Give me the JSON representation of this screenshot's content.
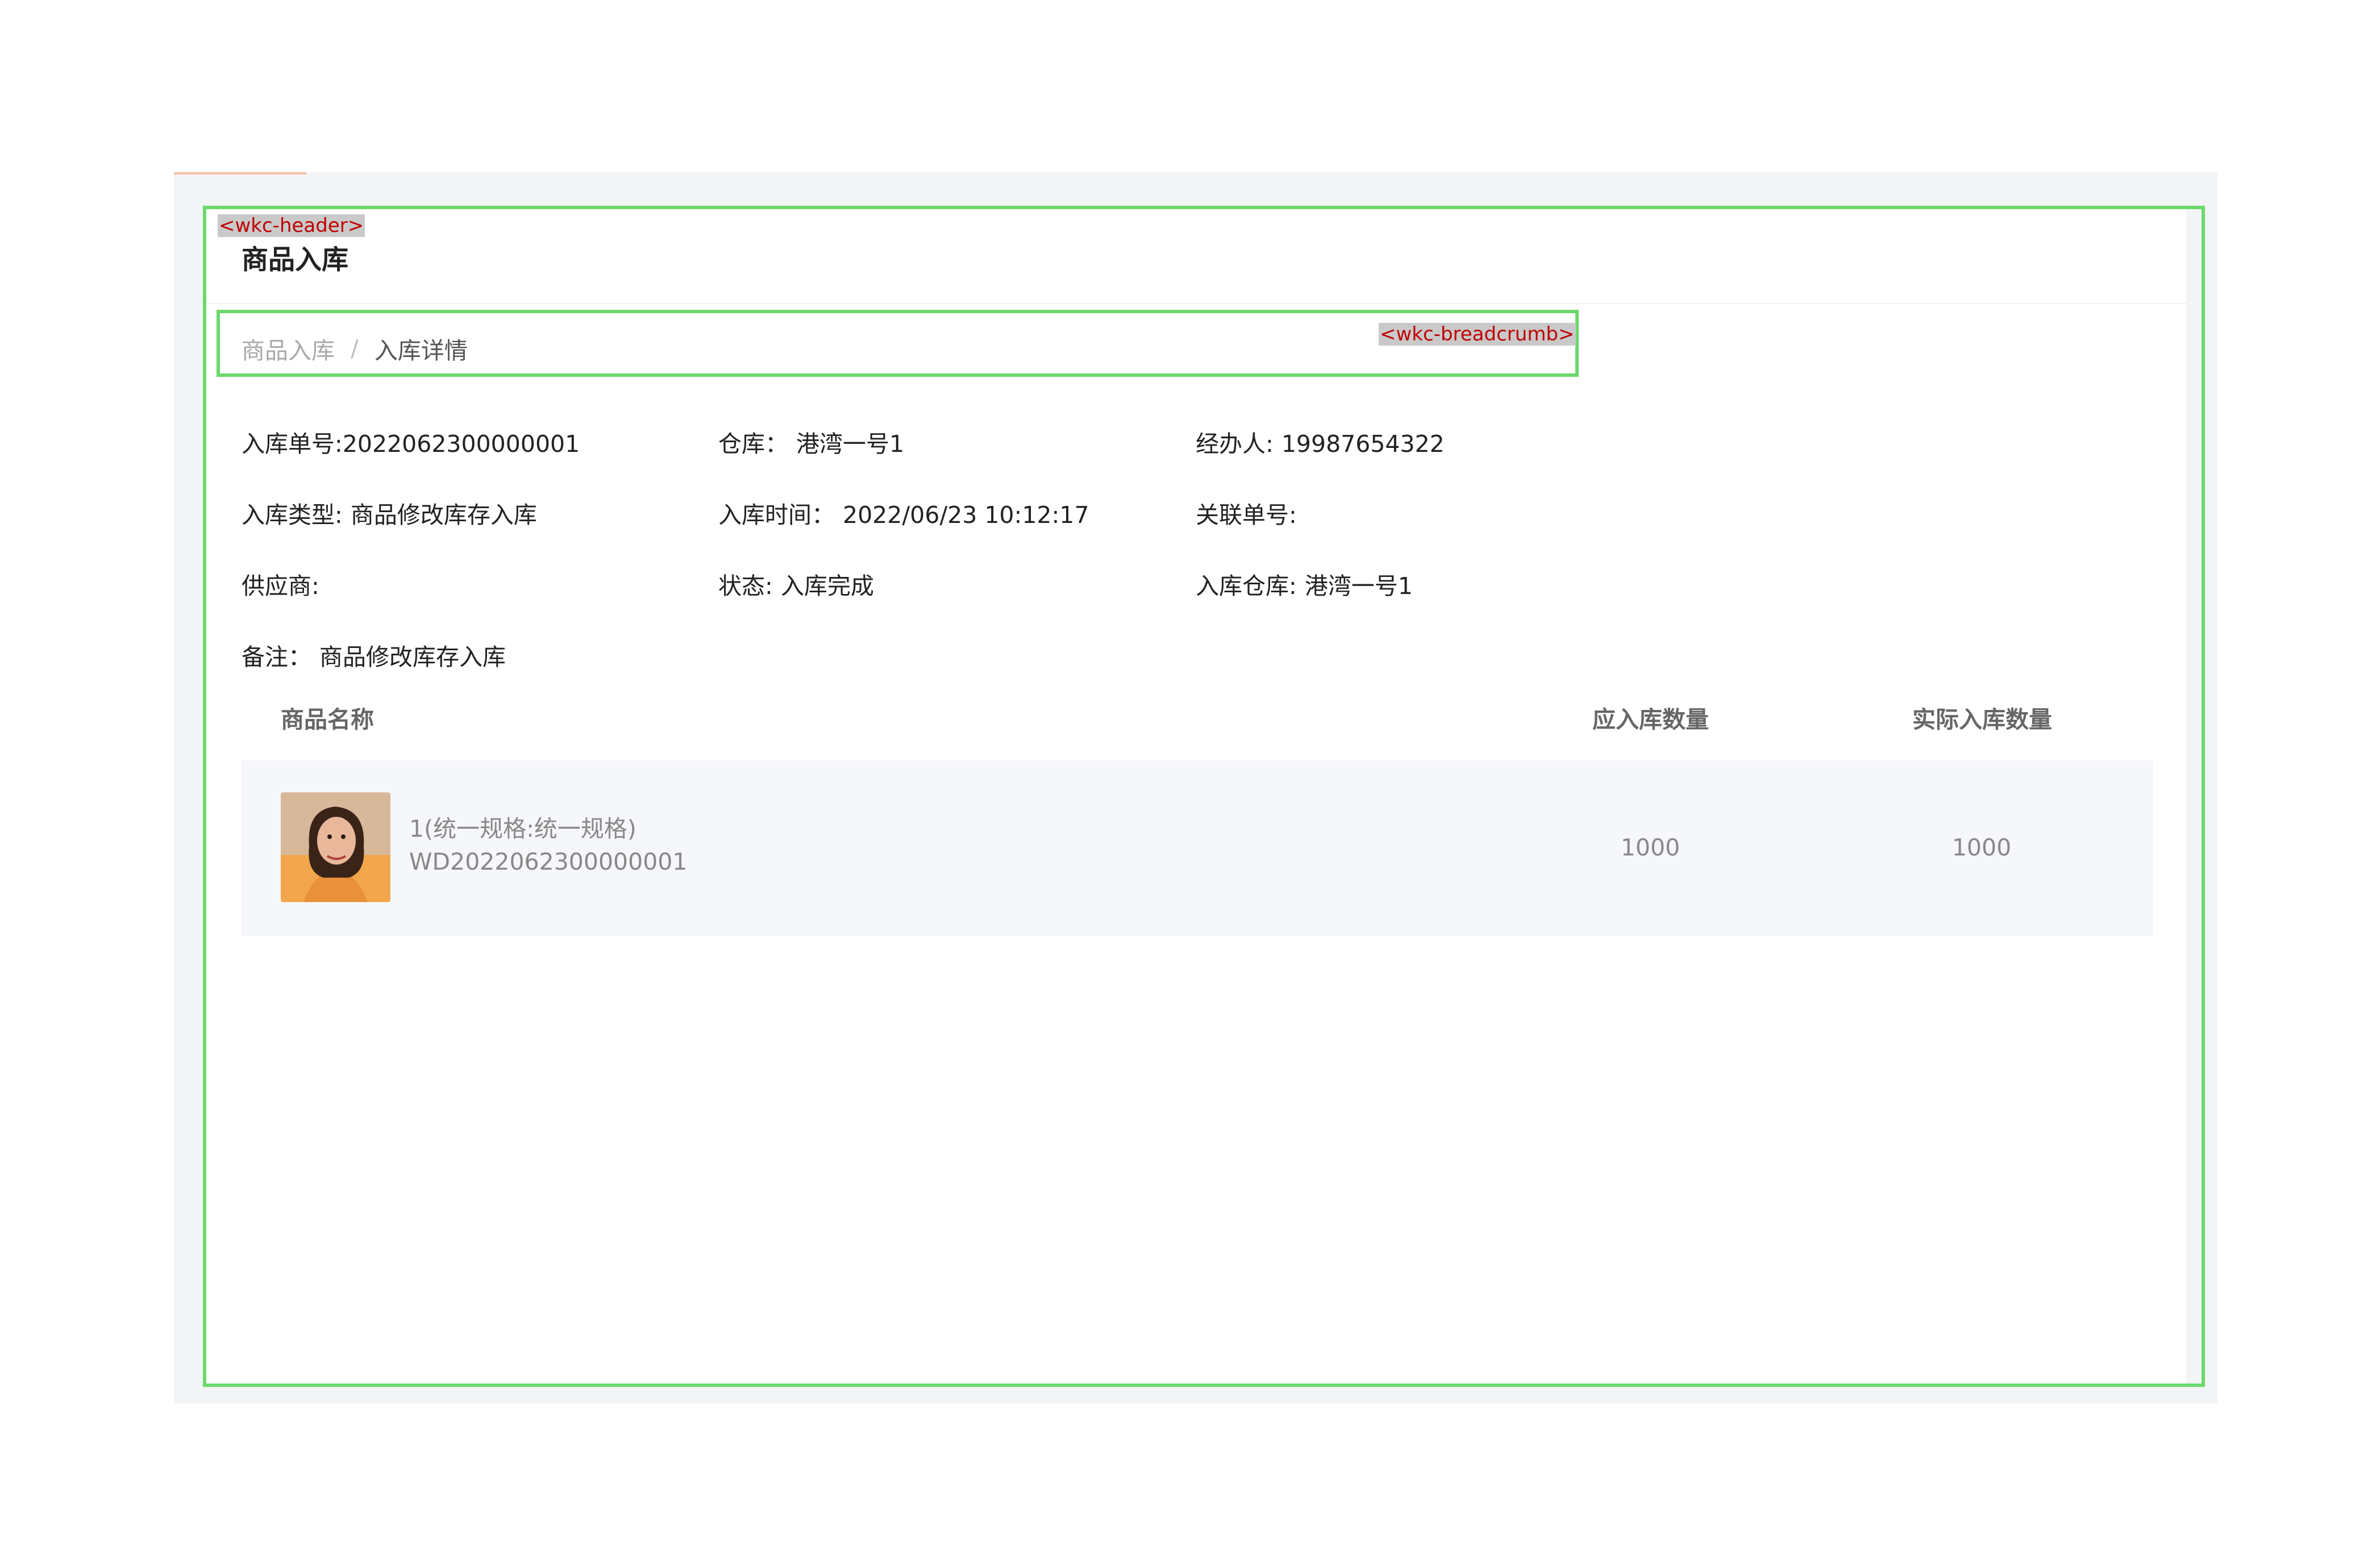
{
  "annotations": {
    "header_tag": "<wkc-header>",
    "breadcrumb_tag": "<wkc-breadcrumb>"
  },
  "header": {
    "title": "商品入库"
  },
  "breadcrumb": {
    "items": [
      "商品入库",
      "入库详情"
    ],
    "separator": "/"
  },
  "info": {
    "order_no_label": "入库单号:",
    "order_no": "2022062300000001",
    "warehouse_label": "仓库：",
    "warehouse": "港湾一号1",
    "handler_label": "经办人:",
    "handler": "19987654322",
    "type_label": "入库类型:",
    "type": "商品修改库存入库",
    "time_label": "入库时间：",
    "time": "2022/06/23 10:12:17",
    "related_label": "关联单号:",
    "related": "",
    "supplier_label": "供应商:",
    "supplier": "",
    "status_label": "状态:",
    "status": "入库完成",
    "in_warehouse_label": "入库仓库:",
    "in_warehouse": "港湾一号1",
    "remark_label": "备注：",
    "remark": "商品修改库存入库"
  },
  "table": {
    "headers": [
      "商品名称",
      "应入库数量",
      "实际入库数量"
    ],
    "rows": [
      {
        "name": "1(统一规格:统一规格)",
        "code": "WD2022062300000001",
        "expected_qty": "1000",
        "actual_qty": "1000",
        "image": "product-photo"
      }
    ]
  },
  "colors": {
    "accent_green": "#6bd96b",
    "tag_red": "#c00000",
    "row_bg": "#f6f7fa"
  }
}
